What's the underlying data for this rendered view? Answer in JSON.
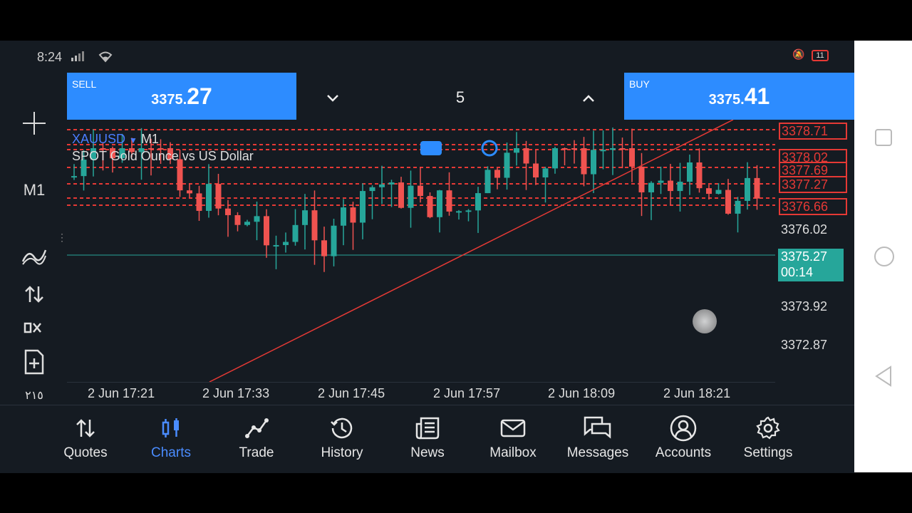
{
  "status_bar": {
    "time": "8:24",
    "battery": "11"
  },
  "trade_panel": {
    "sell_label": "SELL",
    "sell_price_small": "3375.",
    "sell_price_big": "27",
    "buy_label": "BUY",
    "buy_price_small": "3375.",
    "buy_price_big": "41",
    "volume": "5"
  },
  "left_toolbar": {
    "timeframe": "M1",
    "extra": "٢١٥"
  },
  "chart": {
    "symbol": "XAUUSD",
    "timeframe": "M1",
    "description": "SPOT Gold Ounce vs US Dollar",
    "price_labels": [
      "3376.02",
      "3373.92",
      "3372.87"
    ],
    "order_labels": [
      "3378.71",
      "3378.02",
      "3377.69",
      "3377.27",
      "3376.66"
    ],
    "current_price": "3375.27",
    "countdown": "00:14",
    "time_labels": [
      "2 Jun 17:21",
      "2 Jun 17:33",
      "2 Jun 17:45",
      "2 Jun 17:57",
      "2 Jun 18:09",
      "2 Jun 18:21"
    ]
  },
  "bottom_nav": [
    {
      "label": "Quotes",
      "icon": "quotes-icon"
    },
    {
      "label": "Charts",
      "icon": "charts-icon"
    },
    {
      "label": "Trade",
      "icon": "trade-icon"
    },
    {
      "label": "History",
      "icon": "history-icon"
    },
    {
      "label": "News",
      "icon": "news-icon"
    },
    {
      "label": "Mailbox",
      "icon": "mailbox-icon"
    },
    {
      "label": "Messages",
      "icon": "messages-icon"
    },
    {
      "label": "Accounts",
      "icon": "accounts-icon"
    },
    {
      "label": "Settings",
      "icon": "settings-icon"
    }
  ],
  "colors": {
    "bull": "#26a69a",
    "bear": "#ef5350",
    "accent": "#2d8cff",
    "order_line": "#e53935"
  }
}
